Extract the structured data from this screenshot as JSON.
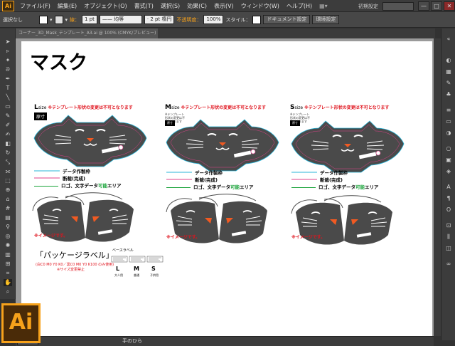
{
  "app": {
    "logo": "Ai",
    "menus": [
      "ファイル(F)",
      "編集(E)",
      "オブジェクト(O)",
      "書式(T)",
      "選択(S)",
      "効果(C)",
      "表示(V)",
      "ウィンドウ(W)",
      "ヘルプ(H)"
    ],
    "workspace": "初期設定",
    "window_buttons": [
      "—",
      "□",
      "✕"
    ]
  },
  "control": {
    "selection": "選択なし",
    "stroke_label": "線：",
    "stroke_weight": "1 pt",
    "stroke_profile": "均等",
    "brush": "2 pt 楕円",
    "opacity_label": "不透明度：",
    "opacity": "100%",
    "style_label": "スタイル：",
    "doc_setup": "ドキュメント設定",
    "prefs": "環境設定"
  },
  "document": {
    "tab": "コーナー_3D_Mask_テンプレート_A3.ai @ 100% (CMYK/プレビュー)"
  },
  "artboard": {
    "title": "マスク",
    "template_note": "※テンプレート形状の変更は不可となります",
    "sizes": [
      {
        "letter": "L",
        "word": "size",
        "tag": "原寸"
      },
      {
        "letter": "M",
        "word": "size",
        "tag": "原寸"
      },
      {
        "letter": "S",
        "word": "size",
        "tag": "原寸"
      }
    ],
    "mini_note": "※テンプレート形状の変更は不可となります",
    "legend": {
      "data_frame": "データ作製枠",
      "cut_line": "断裁(完成)",
      "logo_area_pre": "ロゴ、文字データ",
      "logo_area_green": "可能",
      "logo_area_post": "エリア"
    },
    "image_note": "※イメージです。",
    "package": {
      "title": "「パッケージラベル」",
      "red1": "(白C0 M0 Y0 K0／黒C0 M0 Y0 K100 のみ使用)",
      "red2": "※サイズ変更禁止",
      "base_label": "ベースラベル",
      "letters": [
        "L",
        "M",
        "S"
      ],
      "letter_subs": [
        "大人用",
        "普通",
        "子供用"
      ]
    }
  },
  "status": {
    "tool": "手のひら"
  },
  "colors": {
    "accent": "#f7a21b",
    "mask": "#4a4a4a",
    "red": "#e0141e",
    "green": "#1aa33a",
    "cyan": "#29b6d9",
    "magenta": "#e0408a"
  }
}
